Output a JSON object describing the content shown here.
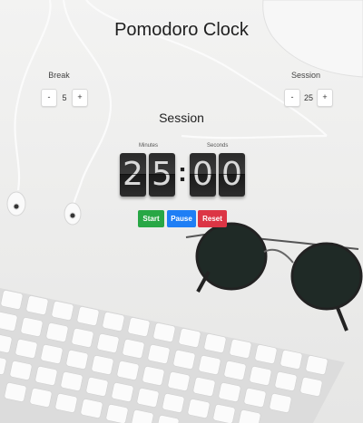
{
  "app": {
    "title": "Pomodoro Clock"
  },
  "break": {
    "label": "Break",
    "decrement": "-",
    "value": "5",
    "increment": "+"
  },
  "session": {
    "label": "Session",
    "decrement": "-",
    "value": "25",
    "increment": "+"
  },
  "timer": {
    "mode": "Session",
    "minutes_label": "Minutes",
    "seconds_label": "Seconds",
    "digits": [
      "2",
      "5",
      "0",
      "0"
    ],
    "separator": ":"
  },
  "actions": {
    "start": "Start",
    "pause": "Pause",
    "reset": "Reset"
  },
  "colors": {
    "start": "#28a745",
    "pause": "#1e7ef5",
    "reset": "#dc3545",
    "digit_bg": "#2a2a2a",
    "digit_fg": "#d9d9d9"
  }
}
